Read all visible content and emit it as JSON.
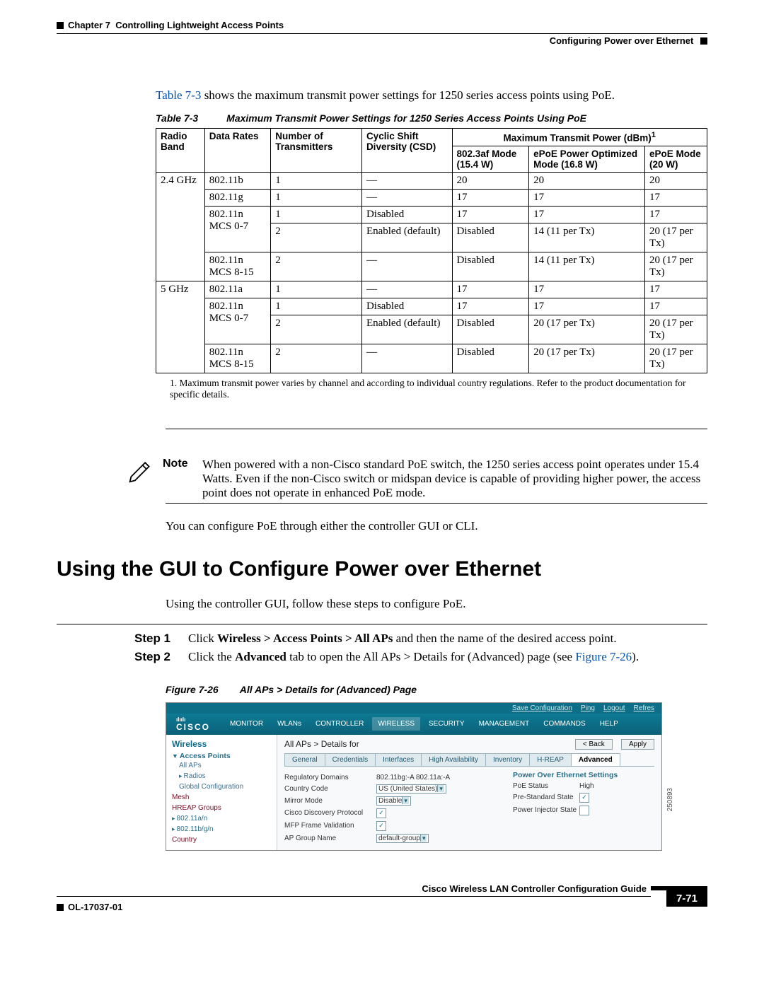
{
  "header": {
    "chapter_label": "Chapter 7",
    "chapter_title": "Controlling Lightweight Access Points",
    "section_title": "Configuring Power over Ethernet"
  },
  "intro": {
    "link": "Table 7-3",
    "text_after": " shows the maximum transmit power settings for 1250 series access points using PoE."
  },
  "table": {
    "caption_num": "Table 7-3",
    "caption_text": "Maximum Transmit Power Settings for 1250 Series Access Points Using PoE",
    "head": {
      "c1": "Radio Band",
      "c2": "Data Rates",
      "c3": "Number of Transmitters",
      "c4": "Cyclic Shift Diversity (CSD)",
      "c5": "Maximum Transmit Power (dBm)",
      "c5_sup": "1",
      "c5a": "802.3af Mode (15.4 W)",
      "c5b": "ePoE Power Optimized Mode (16.8 W)",
      "c5c": "ePoE Mode (20 W)"
    },
    "rows": [
      {
        "band": "2.4 GHz",
        "rate": "802.11b",
        "tx": "1",
        "csd": "—",
        "a": "20",
        "b": "20",
        "c": "20"
      },
      {
        "band": "",
        "rate": "802.11g",
        "tx": "1",
        "csd": "—",
        "a": "17",
        "b": "17",
        "c": "17"
      },
      {
        "band": "",
        "rate": "802.11n MCS 0-7",
        "tx": "1",
        "csd": "Disabled",
        "a": "17",
        "b": "17",
        "c": "17"
      },
      {
        "band": "",
        "rate": "",
        "tx": "2",
        "csd": "Enabled (default)",
        "a": "Disabled",
        "b": "14 (11 per Tx)",
        "c": "20 (17 per Tx)"
      },
      {
        "band": "",
        "rate": "802.11n MCS 8-15",
        "tx": "2",
        "csd": "—",
        "a": "Disabled",
        "b": "14 (11 per Tx)",
        "c": "20 (17 per Tx)"
      },
      {
        "band": "5 GHz",
        "rate": "802.11a",
        "tx": "1",
        "csd": "—",
        "a": "17",
        "b": "17",
        "c": "17"
      },
      {
        "band": "",
        "rate": "802.11n MCS 0-7",
        "tx": "1",
        "csd": "Disabled",
        "a": "17",
        "b": "17",
        "c": "17"
      },
      {
        "band": "",
        "rate": "",
        "tx": "2",
        "csd": "Enabled (default)",
        "a": "Disabled",
        "b": "20 (17 per Tx)",
        "c": "20 (17 per Tx)"
      },
      {
        "band": "",
        "rate": "802.11n MCS 8-15",
        "tx": "2",
        "csd": "—",
        "a": "Disabled",
        "b": "20 (17 per Tx)",
        "c": "20 (17 per Tx)"
      }
    ],
    "footnote_num": "1.",
    "footnote": "Maximum transmit power varies by channel and according to individual country regulations. Refer to the product documentation for specific details."
  },
  "note": {
    "label": "Note",
    "body": "When powered with a non-Cisco standard PoE switch, the 1250 series access point operates under 15.4 Watts. Even if the non-Cisco switch or midspan device is capable of providing higher power, the access point does not operate in enhanced PoE mode."
  },
  "para_after_note": "You can configure PoE through either the controller GUI or CLI.",
  "h2": "Using the GUI to Configure Power over Ethernet",
  "para_after_h2": "Using the controller GUI, follow these steps to configure PoE.",
  "steps": [
    {
      "label": "Step 1",
      "html_pre": "Click ",
      "bold1": "Wireless > Access Points > All APs",
      "plain1": " and then the name of the desired access point."
    },
    {
      "label": "Step 2",
      "html_pre": "Click the ",
      "bold1": "Advanced",
      "plain1": " tab to open the All APs > Details for (Advanced) page (see ",
      "link": "Figure 7-26",
      "plain2": ")."
    }
  ],
  "figure": {
    "num": "Figure 7-26",
    "title": "All APs > Details for (Advanced) Page",
    "sidecode": "250893"
  },
  "gui": {
    "toplinks": [
      "Save Configuration",
      "Ping",
      "Logout",
      "Refres"
    ],
    "brand": "CISCO",
    "menu": [
      "MONITOR",
      "WLANs",
      "CONTROLLER",
      "WIRELESS",
      "SECURITY",
      "MANAGEMENT",
      "COMMANDS",
      "HELP"
    ],
    "menu_active": "WIRELESS",
    "side_heading": "Wireless",
    "side": {
      "group1": "Access Points",
      "items1": [
        "All APs",
        "Radios",
        "Global Configuration"
      ],
      "items2": [
        "Mesh",
        "HREAP Groups",
        "802.11a/n",
        "802.11b/g/n",
        "Country"
      ]
    },
    "main_title": "All APs > Details for",
    "btn_back": "< Back",
    "btn_apply": "Apply",
    "tabs": [
      "General",
      "Credentials",
      "Interfaces",
      "High Availability",
      "Inventory",
      "H-REAP",
      "Advanced"
    ],
    "left_fields": {
      "reg_label": "Regulatory Domains",
      "reg_val": "802.11bg:-A    802.11a:-A",
      "cc_label": "Country Code",
      "cc_val": "US (United States)",
      "mm_label": "Mirror Mode",
      "mm_val": "Disable",
      "cdp_label": "Cisco Discovery Protocol",
      "cdp_checked": true,
      "mfp_label": "MFP Frame Validation",
      "mfp_checked": true,
      "apg_label": "AP Group Name",
      "apg_val": "default-group"
    },
    "right_head": "Power Over Ethernet Settings",
    "right_fields": {
      "poe_label": "PoE Status",
      "poe_val": "High",
      "pre_label": "Pre-Standard State",
      "pre_checked": true,
      "inj_label": "Power Injector State",
      "inj_checked": false
    }
  },
  "footer": {
    "book": "Cisco Wireless LAN Controller Configuration Guide",
    "ol": "OL-17037-01",
    "page": "7-71"
  }
}
